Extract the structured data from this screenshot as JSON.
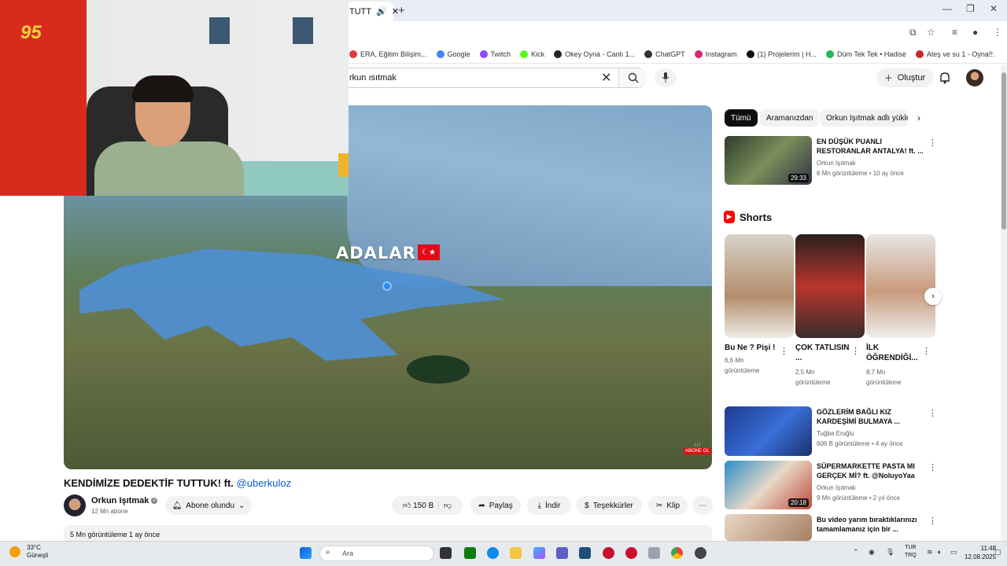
{
  "browser": {
    "tab_title": "TUTT",
    "bookmarks": [
      {
        "label": "ERA, Eğitim Bilişim...",
        "color": "#e53935"
      },
      {
        "label": "Google",
        "color": "#4285f4"
      },
      {
        "label": "Twitch",
        "color": "#9146ff"
      },
      {
        "label": "Kick",
        "color": "#53fc18"
      },
      {
        "label": "Okey Oyna - Canlı 1...",
        "color": "#222222"
      },
      {
        "label": "ChatGPT",
        "color": "#333333"
      },
      {
        "label": "Instagram",
        "color": "#d62976"
      },
      {
        "label": "(1) Projelerim | H...",
        "color": "#111111"
      },
      {
        "label": "Düm Tek Tek • Hadise",
        "color": "#1db954"
      },
      {
        "label": "Ateş ve su 1 - Oyna...",
        "color": "#c62828"
      }
    ]
  },
  "header": {
    "search_value": "rkun ısıtmak",
    "create_label": "Oluştur"
  },
  "player": {
    "map_label": "ADALAR",
    "watermark": "ABONE OL"
  },
  "video": {
    "title": "KENDİMİZE DEDEKTİF TUTTUK! ft.",
    "mention": "@uberkuloz",
    "channel": "Orkun Işıtmak",
    "subs": "12 Mn abone",
    "subscribe_label": "Abone olundu",
    "likes": "150 B",
    "share_label": "Paylaş",
    "download_label": "İndir",
    "thanks_label": "Teşekkürler",
    "clip_label": "Klip",
    "desc_meta": "5 Mn görüntüleme  1 ay önce"
  },
  "sidebar": {
    "chips": [
      "Tümü",
      "Aramanızdan",
      "Orkun Işıtmak adlı yükle"
    ],
    "shorts_heading": "Shorts",
    "videos": [
      {
        "title": "EN DÜŞÜK PUANLI RESTORANLAR ANTALYA! ft. ...",
        "channel": "Orkun Işıtmak",
        "meta": "6 Mn görüntüleme • 10 ay önce",
        "duration": "29:33"
      },
      {
        "title": "GÖZLERİM BAĞLI KIZ KARDEŞİMİ BULMAYA ...",
        "channel": "Tuğba Eroğlu",
        "meta": "606 B görüntüleme • 4 ay önce",
        "duration": ""
      },
      {
        "title": "SÜPERMARKETTE PASTA MI GERÇEK Mİ? ft. @NoluyoYaa",
        "channel": "Orkun Işıtmak",
        "meta": "9 Mn görüntüleme • 2 yıl önce",
        "duration": "20:18"
      },
      {
        "title": "Bu video yarım bıraktıklarınızı tamamlamanız için bir ...",
        "channel": "",
        "meta": "",
        "duration": ""
      }
    ],
    "shorts": [
      {
        "title": "Bu Ne ? Pişi !",
        "views": "6,6 Mn görüntüleme"
      },
      {
        "title": "ÇOK TATLISIN ...",
        "views": "2,5 Mn görüntüleme"
      },
      {
        "title": "İLK ÖĞRENDİĞİ...",
        "views": "8,7 Mn görüntüleme"
      }
    ]
  },
  "taskbar": {
    "temp": "33°C",
    "weather": "Güneşli",
    "search_placeholder": "Ara",
    "lang_1": "TUR",
    "lang_2": "TRQ",
    "time": "11:48",
    "date": "12.08.2025"
  }
}
